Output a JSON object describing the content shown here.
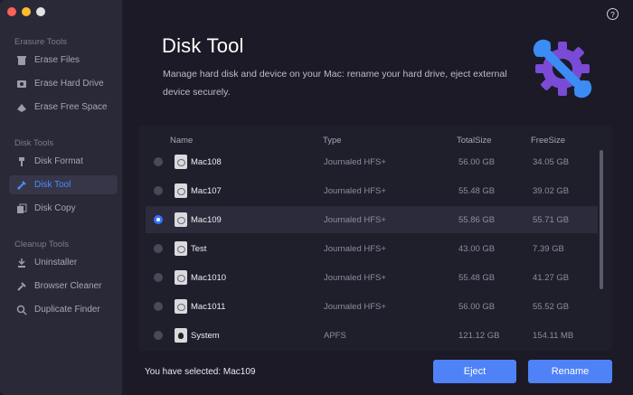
{
  "sidebar": {
    "sections": [
      {
        "title": "Erasure Tools",
        "items": [
          {
            "label": "Erase Files",
            "icon": "erase-files-icon"
          },
          {
            "label": "Erase Hard Drive",
            "icon": "erase-hard-drive-icon"
          },
          {
            "label": "Erase Free Space",
            "icon": "erase-free-space-icon"
          }
        ]
      },
      {
        "title": "Disk Tools",
        "items": [
          {
            "label": "Disk Format",
            "icon": "disk-format-icon"
          },
          {
            "label": "Disk Tool",
            "icon": "disk-tool-icon",
            "active": true
          },
          {
            "label": "Disk Copy",
            "icon": "disk-copy-icon"
          }
        ]
      },
      {
        "title": "Cleanup Tools",
        "items": [
          {
            "label": "Uninstaller",
            "icon": "uninstaller-icon"
          },
          {
            "label": "Browser Cleaner",
            "icon": "browser-cleaner-icon"
          },
          {
            "label": "Duplicate Finder",
            "icon": "duplicate-finder-icon"
          }
        ]
      }
    ]
  },
  "main": {
    "title": "Disk Tool",
    "description": "Manage hard disk and device on your Mac:  rename your hard drive, eject external device securely.",
    "help_label": "?"
  },
  "table": {
    "columns": {
      "name": "Name",
      "type": "Type",
      "total": "TotalSize",
      "free": "FreeSize"
    },
    "rows": [
      {
        "name": "Mac108",
        "type": "Journaled HFS+",
        "total": "56.00 GB",
        "free": "34.05 GB",
        "selected": false
      },
      {
        "name": "Mac107",
        "type": "Journaled HFS+",
        "total": "55.48 GB",
        "free": "39.02 GB",
        "selected": false
      },
      {
        "name": "Mac109",
        "type": "Journaled HFS+",
        "total": "55.86 GB",
        "free": "55.71 GB",
        "selected": true
      },
      {
        "name": "Test",
        "type": "Journaled HFS+",
        "total": "43.00 GB",
        "free": "7.39 GB",
        "selected": false
      },
      {
        "name": "Mac1010",
        "type": "Journaled HFS+",
        "total": "55.48 GB",
        "free": "41.27 GB",
        "selected": false
      },
      {
        "name": "Mac1011",
        "type": "Journaled HFS+",
        "total": "56.00 GB",
        "free": "55.52 GB",
        "selected": false
      },
      {
        "name": "System",
        "type": "APFS",
        "total": "121.12 GB",
        "free": "154.11 MB",
        "selected": false
      }
    ]
  },
  "footer": {
    "selected_text": "You have selected: Mac109",
    "eject_label": "Eject",
    "rename_label": "Rename"
  },
  "colors": {
    "accent": "#4f82f7",
    "active_text": "#4d8dff",
    "hero_blue": "#3c8cf5",
    "hero_purple": "#7a4bd6"
  }
}
